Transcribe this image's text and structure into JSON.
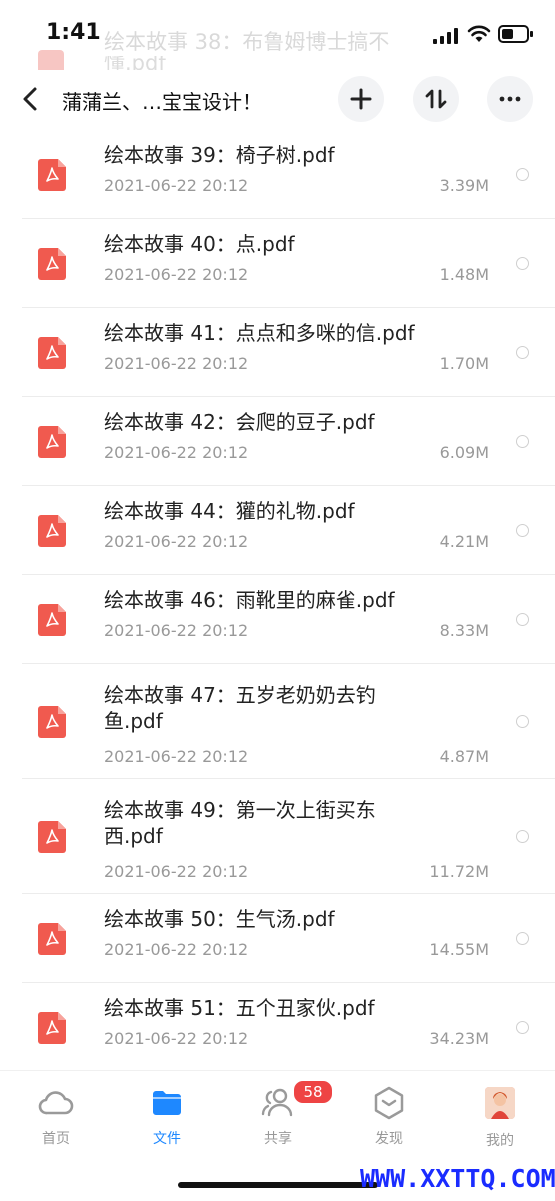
{
  "status_bar": {
    "time": "1:41",
    "ghost_line1": "绘本故事 38：布鲁姆博士搞不",
    "ghost_line2": "懂.pdf"
  },
  "header": {
    "title": "蒲蒲兰、…宝宝设计！"
  },
  "files": [
    {
      "name": "绘本故事 39：椅子树.pdf",
      "date": "2021-06-22 20:12",
      "size": "3.39M"
    },
    {
      "name": "绘本故事 40：点.pdf",
      "date": "2021-06-22 20:12",
      "size": "1.48M"
    },
    {
      "name": "绘本故事 41：点点和多咪的信.pdf",
      "date": "2021-06-22 20:12",
      "size": "1.70M"
    },
    {
      "name": "绘本故事 42：会爬的豆子.pdf",
      "date": "2021-06-22 20:12",
      "size": "6.09M"
    },
    {
      "name": "绘本故事 44：獾的礼物.pdf",
      "date": "2021-06-22 20:12",
      "size": "4.21M"
    },
    {
      "name": "绘本故事 46：雨靴里的麻雀.pdf",
      "date": "2021-06-22 20:12",
      "size": "8.33M"
    },
    {
      "name": "绘本故事 47：五岁老奶奶去钓鱼.pdf",
      "date": "2021-06-22 20:12",
      "size": "4.87M"
    },
    {
      "name": "绘本故事 49：第一次上街买东西.pdf",
      "date": "2021-06-22 20:12",
      "size": "11.72M"
    },
    {
      "name": "绘本故事 50：生气汤.pdf",
      "date": "2021-06-22 20:12",
      "size": "14.55M"
    },
    {
      "name": "绘本故事 51：五个丑家伙.pdf",
      "date": "2021-06-22 20:12",
      "size": "34.23M"
    }
  ],
  "tabs": [
    {
      "label": "首页",
      "icon": "cloud-icon"
    },
    {
      "label": "文件",
      "icon": "folder-icon",
      "active": true
    },
    {
      "label": "共享",
      "icon": "people-icon",
      "badge": "58"
    },
    {
      "label": "发现",
      "icon": "discover-icon"
    },
    {
      "label": "我的",
      "icon": "avatar"
    }
  ],
  "watermark": "WWW.XXTTQ.COM",
  "colors": {
    "accent": "#1e88ff",
    "pdf_red": "#f05a4f",
    "badge_red": "#ee4444",
    "watermark": "#1a2cff"
  }
}
